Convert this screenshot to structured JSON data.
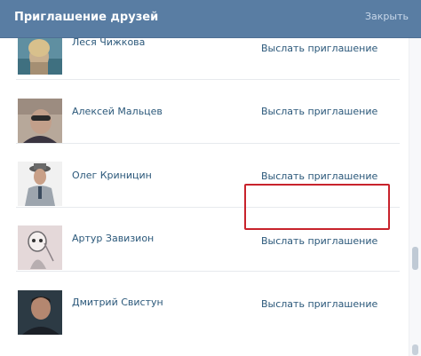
{
  "dialog": {
    "title": "Приглашение друзей",
    "close_label": "Закрыть"
  },
  "friends": [
    {
      "name": "Леся Чижкова",
      "action": "Выслать приглашение",
      "avatar": "photo-blonde-woman"
    },
    {
      "name": "Алексей Мальцев",
      "action": "Выслать приглашение",
      "avatar": "photo-man-sunglasses"
    },
    {
      "name": "Олег Криницин",
      "action": "Выслать приглашение",
      "avatar": "photo-man-hat"
    },
    {
      "name": "Артур Завизион",
      "action": "Выслать приглашение",
      "avatar": "photo-mask-figure"
    },
    {
      "name": "Дмитрий Свистун",
      "action": "Выслать приглашение",
      "avatar": "photo-man-dark"
    }
  ],
  "highlighted_row_index": 3,
  "colors": {
    "header": "#597da3",
    "link": "#2b587a",
    "highlight_border": "#c8232c"
  }
}
